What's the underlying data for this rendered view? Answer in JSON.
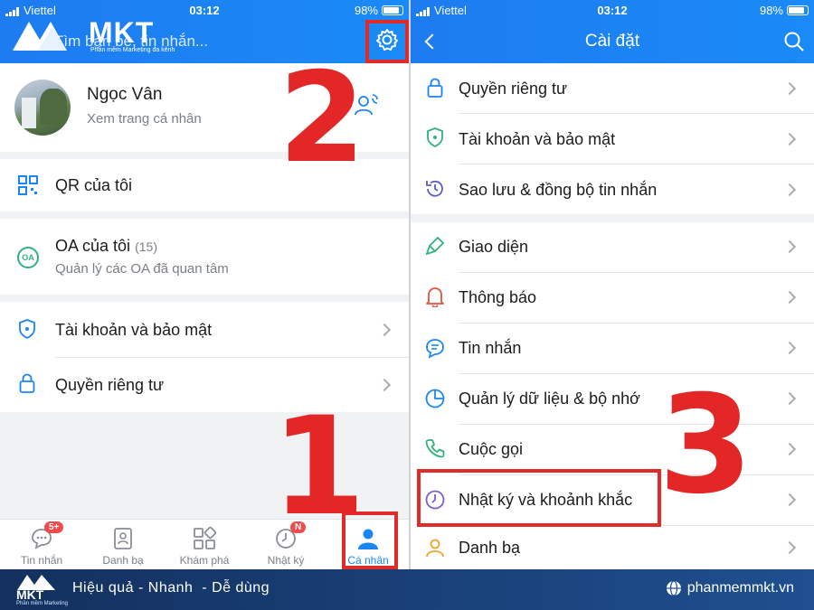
{
  "brand": {
    "logo_text": "MKT",
    "logo_sub": "Phần mềm Marketing đa kênh",
    "footer_logo_sub": "Phần mềm Marketing"
  },
  "left": {
    "status": {
      "carrier": "Viettel",
      "time": "03:12",
      "battery": "98%"
    },
    "search_text": "Tìm bạn bè, tin nhắn...",
    "profile": {
      "name": "Ngọc Vân",
      "subtitle": "Xem trang cá nhân"
    },
    "qr_label": "QR của tôi",
    "oa": {
      "label": "OA của tôi",
      "count": "(15)",
      "subtitle": "Quản lý các OA đã quan tâm",
      "icon_text": "OA"
    },
    "menu": [
      {
        "label": "Tài khoản và bảo mật"
      },
      {
        "label": "Quyền riêng tư"
      }
    ],
    "tabs": [
      {
        "label": "Tin nhắn",
        "badge": "5+"
      },
      {
        "label": "Danh bạ"
      },
      {
        "label": "Khám phá"
      },
      {
        "label": "Nhật ký",
        "badge": "N"
      },
      {
        "label": "Cá nhân",
        "active": true
      }
    ],
    "annotation": {
      "step_settings": "2",
      "step_tab": "1"
    }
  },
  "right": {
    "status": {
      "carrier": "Viettel",
      "time": "03:12",
      "battery": "98%"
    },
    "title": "Cài đặt",
    "group1": [
      {
        "label": "Quyền riêng tư",
        "icon": "lock-icon"
      },
      {
        "label": "Tài khoản và bảo mật",
        "icon": "shield-icon"
      },
      {
        "label": "Sao lưu & đồng bộ tin nhắn",
        "icon": "backup-clock-icon"
      }
    ],
    "group2": [
      {
        "label": "Giao diện",
        "icon": "paint-brush-icon"
      },
      {
        "label": "Thông báo",
        "icon": "bell-icon"
      },
      {
        "label": "Tin nhắn",
        "icon": "message-icon"
      },
      {
        "label": "Quản lý dữ liệu & bộ nhớ",
        "icon": "pie-chart-icon"
      },
      {
        "label": "Cuộc gọi",
        "icon": "phone-icon"
      },
      {
        "label": "Nhật ký và khoảnh khắc",
        "icon": "clock-icon"
      },
      {
        "label": "Danh bạ",
        "icon": "person-icon"
      }
    ],
    "annotation": {
      "step": "3"
    }
  },
  "footer": {
    "slogan": "Hiệu quả - Nhanh  - Dễ dùng",
    "website": "phanmemmkt.vn"
  },
  "colors": {
    "accent": "#1a86f4",
    "annotation_red": "#e02b2b",
    "footer_bg": "#163a6e"
  }
}
